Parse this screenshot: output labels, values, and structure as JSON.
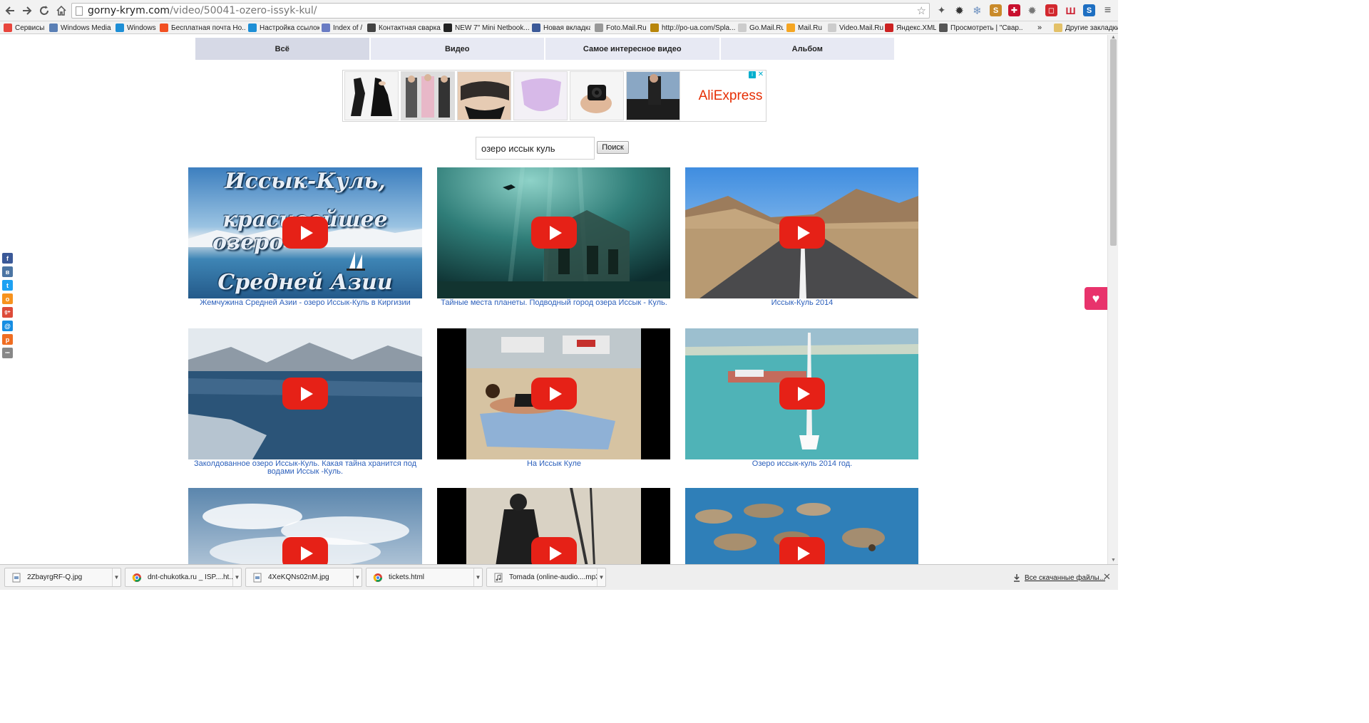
{
  "browser": {
    "url_host": "gorny-krym.com",
    "url_path": "/video/50041-ozero-issyk-kul/",
    "bookmarks": [
      {
        "label": "Сервисы",
        "color": "#e8453c"
      },
      {
        "label": "Windows Media",
        "color": "#5a7fb5"
      },
      {
        "label": "Windows",
        "color": "#1e8fd6"
      },
      {
        "label": "Бесплатная почта Ho...",
        "color": "#f25022"
      },
      {
        "label": "Настройка ссылок",
        "color": "#1e8fd6"
      },
      {
        "label": "Index of /",
        "color": "#6a7cc4"
      },
      {
        "label": "Контактная сварка |",
        "color": "#444444"
      },
      {
        "label": "NEW 7\" Mini Netbook...",
        "color": "#222222"
      },
      {
        "label": "Новая вкладка",
        "color": "#3b5998"
      },
      {
        "label": "Foto.Mail.Ru",
        "color": "#999999"
      },
      {
        "label": "http://po-ua.com/Spla...",
        "color": "#b8860b"
      },
      {
        "label": "Go.Mail.Ru",
        "color": "#cccccc"
      },
      {
        "label": "Mail.Ru",
        "color": "#f5a623"
      },
      {
        "label": "Video.Mail.Ru",
        "color": "#cccccc"
      },
      {
        "label": "Яндекс.XML",
        "color": "#cc2222"
      },
      {
        "label": "Просмотреть | \"Свар...",
        "color": "#555555"
      }
    ],
    "bookmarks_more": "»",
    "other_bookmarks": "Другие закладки"
  },
  "site_nav": {
    "tabs": [
      "Всё",
      "Видео",
      "Самое интересное видео",
      "Альбом"
    ]
  },
  "ad": {
    "brand": "AliExpress",
    "info_icon": "i",
    "close_icon": "✕"
  },
  "search": {
    "value": "озеро иссык куль",
    "button_label": "Поиск"
  },
  "videos": [
    {
      "title": "Жемчужина Средней Азии - озеро Иссык-Куль в Киргизии",
      "thumb_text": [
        "Иссык-Куль,",
        "красивейшее",
        "озеро",
        "Средней Азии"
      ]
    },
    {
      "title": "Тайные места планеты. Подводный город озера Иссык - Куль."
    },
    {
      "title": "Иссык-Куль 2014"
    },
    {
      "title": "Заколдованное озеро Иссык-Куль. Какая тайна хранится под водами Иссык -Куль."
    },
    {
      "title": "На Иссык Куле"
    },
    {
      "title": "Озеро иссык-куль 2014 год."
    },
    {
      "title": ""
    },
    {
      "title": ""
    },
    {
      "title": ""
    }
  ],
  "share_buttons": [
    {
      "icon": "facebook-icon",
      "glyph": "f",
      "color": "#3b5998"
    },
    {
      "icon": "vk-icon",
      "glyph": "в",
      "color": "#4c75a3"
    },
    {
      "icon": "twitter-icon",
      "glyph": "t",
      "color": "#1da1f2"
    },
    {
      "icon": "odnoklassniki-icon",
      "glyph": "о",
      "color": "#f7931e"
    },
    {
      "icon": "google-plus-icon",
      "glyph": "g+",
      "color": "#dd4b39"
    },
    {
      "icon": "mail-icon",
      "glyph": "@",
      "color": "#168de2"
    },
    {
      "icon": "livejournal-icon",
      "glyph": "p",
      "color": "#f06d22"
    },
    {
      "icon": "more-icon",
      "glyph": "•••",
      "color": "#888888"
    }
  ],
  "downloads": [
    {
      "name": "2ZbayrgRF-Q.jpg",
      "icon": "image-file-icon"
    },
    {
      "name": "dnt-chukotka.ru _ ISP....ht...",
      "icon": "chrome-file-icon"
    },
    {
      "name": "4XeKQNs02nM.jpg",
      "icon": "image-file-icon"
    },
    {
      "name": "tickets.html",
      "icon": "chrome-file-icon"
    },
    {
      "name": "Tomada (online-audio....mp3",
      "icon": "audio-file-icon"
    }
  ],
  "all_downloads_label": "Все скачанные файлы...",
  "close_icon": "✕",
  "colors": {
    "link": "#2b5fbb",
    "play_red": "#e62117",
    "tab_bg": "#e7e9f3",
    "aliexpress": "#e62e04",
    "like_pink": "#e8336c"
  }
}
